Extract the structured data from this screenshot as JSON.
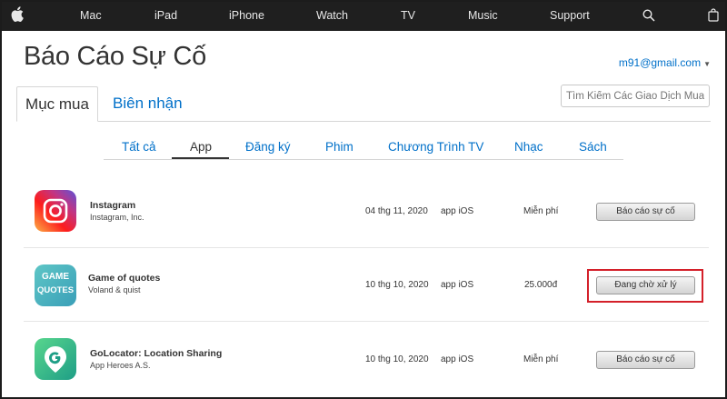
{
  "nav": {
    "items": [
      "Mac",
      "iPad",
      "iPhone",
      "Watch",
      "TV",
      "Music",
      "Support"
    ],
    "icons": [
      "apple-logo-icon",
      "search-icon",
      "bag-icon"
    ]
  },
  "header": {
    "title": "Báo Cáo Sự Cố",
    "account": "m91@gmail.com"
  },
  "tabs": {
    "purchases": "Mục mua",
    "receipts": "Biên nhận"
  },
  "search": {
    "placeholder": "Tìm Kiếm Các Giao Dịch Mua H"
  },
  "filters": [
    "Tất cả",
    "App",
    "Đăng ký",
    "Phim",
    "Chương Trình TV",
    "Nhạc",
    "Sách"
  ],
  "active_filter": "App",
  "rows": [
    {
      "name": "Instagram",
      "developer": "Instagram, Inc.",
      "date": "04 thg 11, 2020",
      "type": "app iOS",
      "price": "Miễn phí",
      "action": "Báo cáo sự cố",
      "icon": "instagram-app-icon"
    },
    {
      "name": "Game of quotes",
      "developer": "Voland & quist",
      "date": "10 thg 10, 2020",
      "type": "app iOS",
      "price": "25.000đ",
      "action": "Đang chờ xử lý",
      "icon": "game-of-quotes-app-icon",
      "icon_text_1": "GAME",
      "icon_text_2": "QUOTES"
    },
    {
      "name": "GoLocator: Location Sharing",
      "developer": "App Heroes A.S.",
      "date": "10 thg 10, 2020",
      "type": "app iOS",
      "price": "Miễn phí",
      "action": "Báo cáo sự cố",
      "icon": "golocator-app-icon"
    }
  ],
  "colors": {
    "nav_bg": "#1f1f1f",
    "link": "#0070c9",
    "highlight": "#d4202a"
  }
}
